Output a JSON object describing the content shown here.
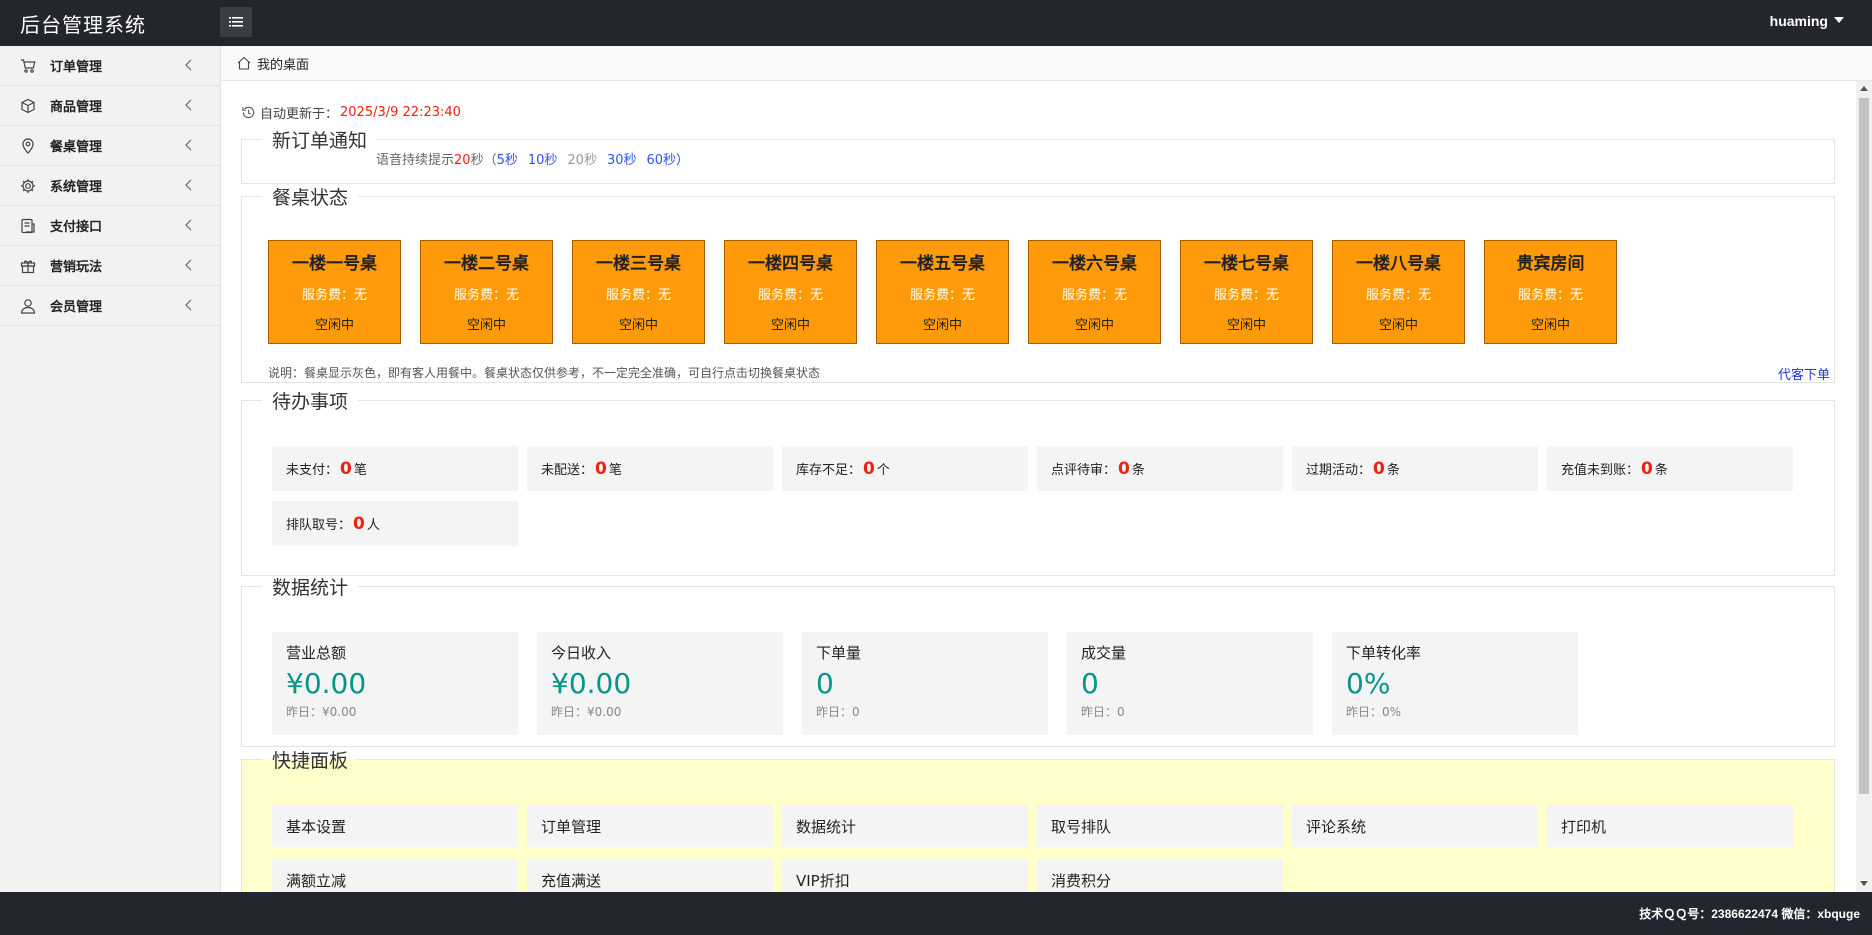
{
  "app": {
    "title": "后台管理系统",
    "user": "huaming"
  },
  "sidebar": {
    "items": [
      {
        "label": "订单管理",
        "icon": "cart-icon"
      },
      {
        "label": "商品管理",
        "icon": "box-icon"
      },
      {
        "label": "餐桌管理",
        "icon": "location-icon"
      },
      {
        "label": "系统管理",
        "icon": "gear-icon"
      },
      {
        "label": "支付接口",
        "icon": "payment-icon"
      },
      {
        "label": "营销玩法",
        "icon": "gift-icon"
      },
      {
        "label": "会员管理",
        "icon": "user-icon"
      }
    ]
  },
  "breadcrumb": {
    "label": "我的桌面"
  },
  "autoupdate": {
    "label": "自动更新于：",
    "time": "2025/3/9 22:23:40"
  },
  "notice": {
    "title": "新订单通知",
    "prefix": "语音持续提示",
    "current": "20",
    "unit": "秒（",
    "opts": [
      "5秒",
      "10秒",
      "20秒",
      "30秒",
      "60秒）"
    ]
  },
  "tables_section": {
    "title": "餐桌状态",
    "fee_label": "服务费：无",
    "status_label": "空闲中",
    "tables": [
      "一楼一号桌",
      "一楼二号桌",
      "一楼三号桌",
      "一楼四号桌",
      "一楼五号桌",
      "一楼六号桌",
      "一楼七号桌",
      "一楼八号桌",
      "贵宾房间"
    ],
    "note": "说明：餐桌显示灰色，即有客人用餐中。餐桌状态仅供参考，不一定完全准确，可自行点击切换餐桌状态",
    "link": "代客下单"
  },
  "todo": {
    "title": "待办事项",
    "items": [
      {
        "label": "未支付：",
        "num": "0",
        "unit": "笔"
      },
      {
        "label": "未配送：",
        "num": "0",
        "unit": "笔"
      },
      {
        "label": "库存不足：",
        "num": "0",
        "unit": "个"
      },
      {
        "label": "点评待审：",
        "num": "0",
        "unit": "条"
      },
      {
        "label": "过期活动：",
        "num": "0",
        "unit": "条"
      },
      {
        "label": "充值未到账：",
        "num": "0",
        "unit": "条"
      },
      {
        "label": "排队取号：",
        "num": "0",
        "unit": "人"
      }
    ]
  },
  "stats": {
    "title": "数据统计",
    "items": [
      {
        "label": "营业总额",
        "value": "¥0.00",
        "yesterday": "昨日：¥0.00"
      },
      {
        "label": "今日收入",
        "value": "¥0.00",
        "yesterday": "昨日：¥0.00"
      },
      {
        "label": "下单量",
        "value": "0",
        "yesterday": "昨日：0"
      },
      {
        "label": "成交量",
        "value": "0",
        "yesterday": "昨日：0"
      },
      {
        "label": "下单转化率",
        "value": "0%",
        "yesterday": "昨日：0%"
      }
    ]
  },
  "quick": {
    "title": "快捷面板",
    "items": [
      "基本设置",
      "订单管理",
      "数据统计",
      "取号排队",
      "评论系统",
      "打印机",
      "满额立减",
      "充值满送",
      "VIP折扣",
      "消费积分"
    ]
  },
  "footer": {
    "text": "技术ＱＱ号：2386622474 微信：xbquge"
  },
  "colors": {
    "topbar": "#23262e",
    "table_card": "#ff9b0a",
    "accent_num": "#009688",
    "alert": "#e21111",
    "quick_bg": "#ffffcc"
  }
}
